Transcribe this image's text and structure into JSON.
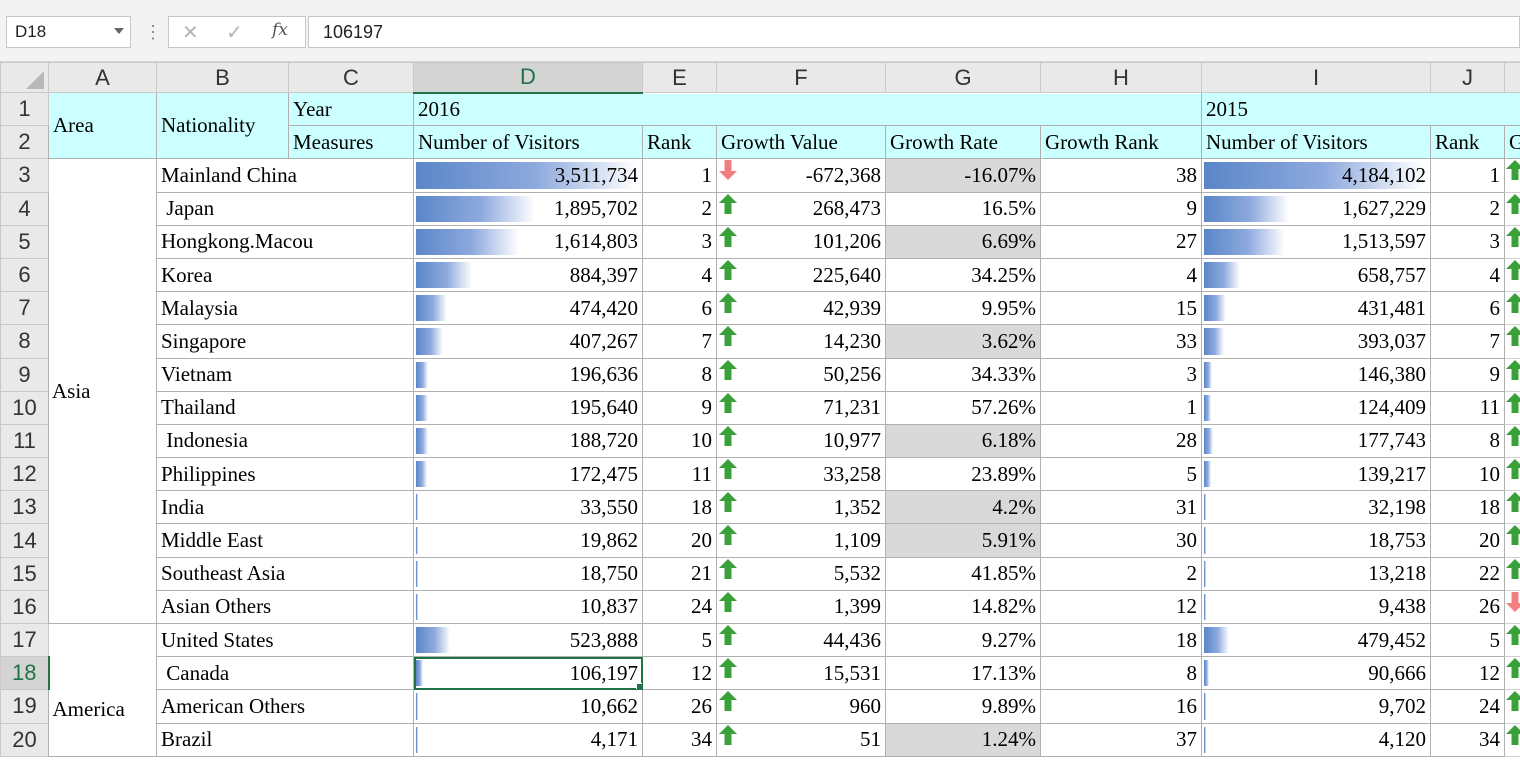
{
  "formula_bar": {
    "name_box": "D18",
    "cancel_icon": "close-icon",
    "enter_icon": "check-icon",
    "fx_label": "fx",
    "formula_value": "106197"
  },
  "columns": [
    "A",
    "B",
    "C",
    "D",
    "E",
    "F",
    "G",
    "H",
    "I",
    "J"
  ],
  "active_cell": {
    "column": "D",
    "row": "18"
  },
  "headers": {
    "area": "Area",
    "nationality": "Nationality",
    "year": "Year",
    "measures": "Measures",
    "year_2016": "2016",
    "year_2015": "2015",
    "visitors": "Number of Visitors",
    "rank": "Rank",
    "growth_value": "Growth Value",
    "growth_rate": "Growth Rate",
    "growth_rank": "Growth Rank",
    "col_k_partial": "G"
  },
  "areas": {
    "asia": "Asia",
    "america": "America"
  },
  "rows": [
    {
      "row": "3",
      "nationality": "Mainland China",
      "v2016": "3,511,734",
      "v2016_frac": 0.98,
      "rank2016": "1",
      "dir": "down",
      "growth": "-672,368",
      "rate": "-16.07%",
      "rate_shaded": true,
      "grank": "38",
      "v2015": "4,184,102",
      "v2015_frac": 0.98,
      "rank2015": "1",
      "dir2015": "up"
    },
    {
      "row": "4",
      "nationality": " Japan",
      "v2016": "1,895,702",
      "v2016_frac": 0.53,
      "rank2016": "2",
      "dir": "up",
      "growth": "268,473",
      "rate": "16.5%",
      "rate_shaded": false,
      "grank": "9",
      "v2015": "1,627,229",
      "v2015_frac": 0.38,
      "rank2015": "2",
      "dir2015": "up"
    },
    {
      "row": "5",
      "nationality": "Hongkong.Macou",
      "v2016": "1,614,803",
      "v2016_frac": 0.46,
      "rank2016": "3",
      "dir": "up",
      "growth": "101,206",
      "rate": "6.69%",
      "rate_shaded": true,
      "grank": "27",
      "v2015": "1,513,597",
      "v2015_frac": 0.36,
      "rank2015": "3",
      "dir2015": "up"
    },
    {
      "row": "6",
      "nationality": "Korea",
      "v2016": "884,397",
      "v2016_frac": 0.25,
      "rank2016": "4",
      "dir": "up",
      "growth": "225,640",
      "rate": "34.25%",
      "rate_shaded": false,
      "grank": "4",
      "v2015": "658,757",
      "v2015_frac": 0.16,
      "rank2015": "4",
      "dir2015": "up"
    },
    {
      "row": "7",
      "nationality": "Malaysia",
      "v2016": "474,420",
      "v2016_frac": 0.14,
      "rank2016": "6",
      "dir": "up",
      "growth": "42,939",
      "rate": "9.95%",
      "rate_shaded": false,
      "grank": "15",
      "v2015": "431,481",
      "v2015_frac": 0.1,
      "rank2015": "6",
      "dir2015": "up"
    },
    {
      "row": "8",
      "nationality": "Singapore",
      "v2016": "407,267",
      "v2016_frac": 0.12,
      "rank2016": "7",
      "dir": "up",
      "growth": "14,230",
      "rate": "3.62%",
      "rate_shaded": true,
      "grank": "33",
      "v2015": "393,037",
      "v2015_frac": 0.09,
      "rank2015": "7",
      "dir2015": "up"
    },
    {
      "row": "9",
      "nationality": "Vietnam",
      "v2016": "196,636",
      "v2016_frac": 0.055,
      "rank2016": "8",
      "dir": "up",
      "growth": "50,256",
      "rate": "34.33%",
      "rate_shaded": false,
      "grank": "3",
      "v2015": "146,380",
      "v2015_frac": 0.035,
      "rank2015": "9",
      "dir2015": "up"
    },
    {
      "row": "10",
      "nationality": "Thailand",
      "v2016": "195,640",
      "v2016_frac": 0.055,
      "rank2016": "9",
      "dir": "up",
      "growth": "71,231",
      "rate": "57.26%",
      "rate_shaded": false,
      "grank": "1",
      "v2015": "124,409",
      "v2015_frac": 0.03,
      "rank2015": "11",
      "dir2015": "up"
    },
    {
      "row": "11",
      "nationality": " Indonesia",
      "v2016": "188,720",
      "v2016_frac": 0.054,
      "rank2016": "10",
      "dir": "up",
      "growth": "10,977",
      "rate": "6.18%",
      "rate_shaded": true,
      "grank": "28",
      "v2015": "177,743",
      "v2015_frac": 0.042,
      "rank2015": "8",
      "dir2015": "up"
    },
    {
      "row": "12",
      "nationality": "Philippines",
      "v2016": "172,475",
      "v2016_frac": 0.05,
      "rank2016": "11",
      "dir": "up",
      "growth": "33,258",
      "rate": "23.89%",
      "rate_shaded": false,
      "grank": "5",
      "v2015": "139,217",
      "v2015_frac": 0.033,
      "rank2015": "10",
      "dir2015": "up"
    },
    {
      "row": "13",
      "nationality": "India",
      "v2016": "33,550",
      "v2016_frac": 0.01,
      "rank2016": "18",
      "dir": "up",
      "growth": "1,352",
      "rate": "4.2%",
      "rate_shaded": true,
      "grank": "31",
      "v2015": "32,198",
      "v2015_frac": 0.008,
      "rank2015": "18",
      "dir2015": "up"
    },
    {
      "row": "14",
      "nationality": "Middle East",
      "v2016": "19,862",
      "v2016_frac": 0.006,
      "rank2016": "20",
      "dir": "up",
      "growth": "1,109",
      "rate": "5.91%",
      "rate_shaded": true,
      "grank": "30",
      "v2015": "18,753",
      "v2015_frac": 0.005,
      "rank2015": "20",
      "dir2015": "up"
    },
    {
      "row": "15",
      "nationality": "Southeast Asia",
      "v2016": "18,750",
      "v2016_frac": 0.006,
      "rank2016": "21",
      "dir": "up",
      "growth": "5,532",
      "rate": "41.85%",
      "rate_shaded": false,
      "grank": "2",
      "v2015": "13,218",
      "v2015_frac": 0.004,
      "rank2015": "22",
      "dir2015": "up"
    },
    {
      "row": "16",
      "nationality": "Asian Others",
      "v2016": "10,837",
      "v2016_frac": 0,
      "rank2016": "24",
      "dir": "up",
      "growth": "1,399",
      "rate": "14.82%",
      "rate_shaded": false,
      "grank": "12",
      "v2015": "9,438",
      "v2015_frac": 0,
      "rank2015": "26",
      "dir2015": "down"
    },
    {
      "row": "17",
      "nationality": "United States",
      "v2016": "523,888",
      "v2016_frac": 0.15,
      "rank2016": "5",
      "dir": "up",
      "growth": "44,436",
      "rate": "9.27%",
      "rate_shaded": false,
      "grank": "18",
      "v2015": "479,452",
      "v2015_frac": 0.11,
      "rank2015": "5",
      "dir2015": "up"
    },
    {
      "row": "18",
      "nationality": " Canada",
      "v2016": "106,197",
      "v2016_frac": 0.03,
      "rank2016": "12",
      "dir": "up",
      "growth": "15,531",
      "rate": "17.13%",
      "rate_shaded": false,
      "grank": "8",
      "v2015": "90,666",
      "v2015_frac": 0.022,
      "rank2015": "12",
      "dir2015": "up"
    },
    {
      "row": "19",
      "nationality": "American Others",
      "v2016": "10,662",
      "v2016_frac": 0,
      "rank2016": "26",
      "dir": "up",
      "growth": "960",
      "rate": "9.89%",
      "rate_shaded": false,
      "grank": "16",
      "v2015": "9,702",
      "v2015_frac": 0,
      "rank2015": "24",
      "dir2015": "up"
    },
    {
      "row": "20",
      "nationality": "Brazil",
      "v2016": "4,171",
      "v2016_frac": 0,
      "rank2016": "34",
      "dir": "up",
      "growth": "51",
      "rate": "1.24%",
      "rate_shaded": true,
      "grank": "37",
      "v2015": "4,120",
      "v2015_frac": 0,
      "rank2015": "34",
      "dir2015": "up"
    }
  ],
  "colors": {
    "header_fill": "#ccffff",
    "databar_start": "#5a86c8",
    "shaded_rate": "#d9d9d9",
    "arrow_up": "#3aa03a",
    "arrow_down": "#f08080",
    "selection": "#217346"
  }
}
